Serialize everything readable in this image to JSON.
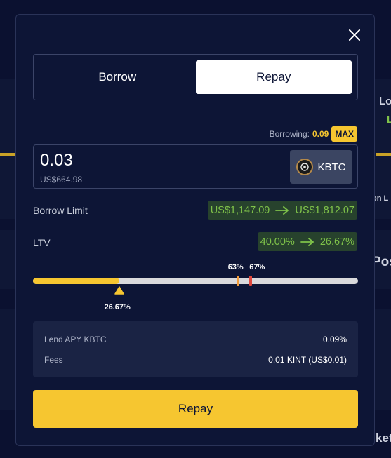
{
  "modal": {
    "tabs": [
      {
        "label": "Borrow",
        "active": false
      },
      {
        "label": "Repay",
        "active": true
      }
    ],
    "borrowing": {
      "label": "Borrowing:",
      "value": "0.09",
      "max_label": "MAX"
    },
    "amount": {
      "value": "0.03",
      "usd": "US$664.98"
    },
    "token": {
      "symbol": "KBTC",
      "icon": "kbtc-token-icon"
    },
    "borrow_limit": {
      "label": "Borrow Limit",
      "from": "US$1,147.09",
      "to": "US$1,812.07"
    },
    "ltv": {
      "label": "LTV",
      "from": "40.00%",
      "to": "26.67%"
    },
    "ltv_slider": {
      "current_percent": 26.67,
      "current_label": "26.67%",
      "warning_percent": 63,
      "warning_label": "63%",
      "liquidation_percent": 67,
      "liquidation_label": "67%"
    },
    "info": [
      {
        "label": "Lend APY KBTC",
        "value": "0.09%"
      },
      {
        "label": "Fees",
        "value": "0.01 KINT (US$0.01)"
      }
    ],
    "submit_label": "Repay"
  },
  "background": {
    "peek_texts": [
      "Lo",
      "L",
      "on L",
      "Pos",
      "ket"
    ]
  },
  "colors": {
    "accent": "#f6c630",
    "positive": "#7fc24a",
    "warning": "#f39c3c",
    "danger": "#e0473d",
    "modal_bg": "#0d1536"
  }
}
